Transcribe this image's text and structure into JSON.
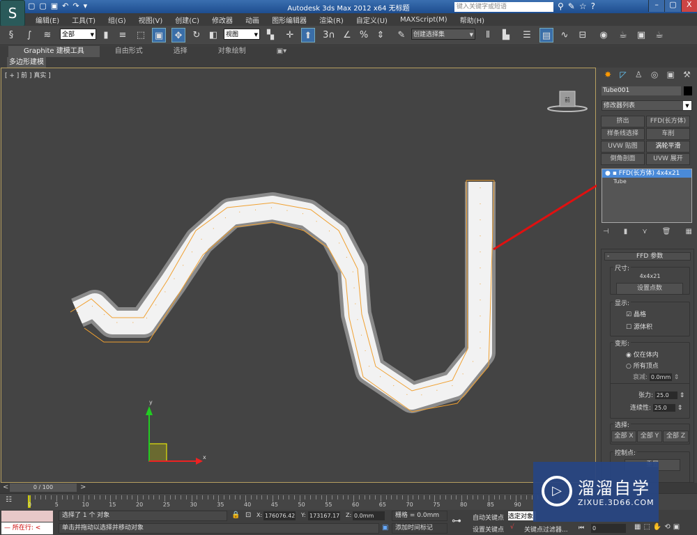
{
  "app": {
    "title": "Autodesk 3ds Max  2012 x64      无标题",
    "search_placeholder": "键入关键字或短语",
    "window_controls": [
      "–",
      "▢",
      "X"
    ]
  },
  "menu": [
    "编辑(E)",
    "工具(T)",
    "组(G)",
    "视图(V)",
    "创建(C)",
    "修改器",
    "动画",
    "图形编辑器",
    "渲染(R)",
    "自定义(U)",
    "MAXScript(M)",
    "帮助(H)"
  ],
  "toolbar": {
    "selection_filter": "全部",
    "ref_coord": "视图",
    "named_selection": "创建选择集",
    "snap_label": "3"
  },
  "ribbon": {
    "tabs": [
      "Graphite 建模工具",
      "自由形式",
      "选择",
      "对象绘制"
    ],
    "active": 0,
    "subtab": "多边形建模"
  },
  "viewport": {
    "label": "[ + ] 前 ] 真实 ]",
    "axis_x": "x",
    "axis_y": "y",
    "viewcube": "前"
  },
  "panel": {
    "object_name": "Tube001",
    "modifier_list": "修改器列表",
    "modifier_buttons": [
      "挤出",
      "FFD(长方体)",
      "样条线选择",
      "车削",
      "UVW 贴图",
      "涡轮平滑",
      "倒角剖面",
      "UVW 展开"
    ],
    "stack": [
      {
        "label": "FFD(长方体) 4x4x21",
        "selected": true
      },
      {
        "label": "Tube",
        "selected": false
      }
    ],
    "rollout_title": "FFD 参数",
    "size": {
      "legend": "尺寸:",
      "value": "4x4x21",
      "button": "设置点数"
    },
    "display": {
      "legend": "显示:",
      "lattice": "晶格",
      "lattice_checked": true,
      "source_volume": "源体积",
      "source_checked": false
    },
    "deform": {
      "legend": "变形:",
      "only_in_volume": "仅在体内",
      "all_vertices": "所有顶点",
      "selected": "仅在体内",
      "falloff_label": "衰减:",
      "falloff": "0.0mm",
      "tension_label": "张力:",
      "tension": "25.0",
      "continuity_label": "连续性:",
      "continuity": "25.0"
    },
    "selection": {
      "legend": "选择:",
      "buttons": [
        "全部 X",
        "全部 Y",
        "全部 Z"
      ]
    },
    "control_points": {
      "legend": "控制点:",
      "button": "重置"
    }
  },
  "timeline": {
    "frame": "0 / 100",
    "ticks": [
      "0",
      "5",
      "10",
      "15",
      "20",
      "25",
      "30",
      "35",
      "40",
      "45",
      "50",
      "55",
      "60",
      "65",
      "70",
      "75",
      "80",
      "85",
      "90"
    ]
  },
  "status": {
    "maxscript": "所在行:",
    "selected": "选择了 1 个 对象",
    "prompt": "单击并拖动以选择并移动对象",
    "x_label": "X:",
    "x": "176076.42",
    "y_label": "Y:",
    "y": "173167.17",
    "z_label": "Z:",
    "z": "0.0mm",
    "grid": "栅格 = 0.0mm",
    "add_time_tag": "添加时间标记",
    "auto_key": "自动关键点",
    "set_key": "设置关键点",
    "key_mode": "选定对象",
    "key_filters": "关键点过滤器...",
    "current_frame": "0"
  },
  "watermark": {
    "brand": "溜溜自学",
    "url": "ZIXUE.3D66.COM"
  },
  "colors": {
    "accent": "#3a6ea8",
    "annotation": "#e01010",
    "lattice": "#f0a030"
  }
}
